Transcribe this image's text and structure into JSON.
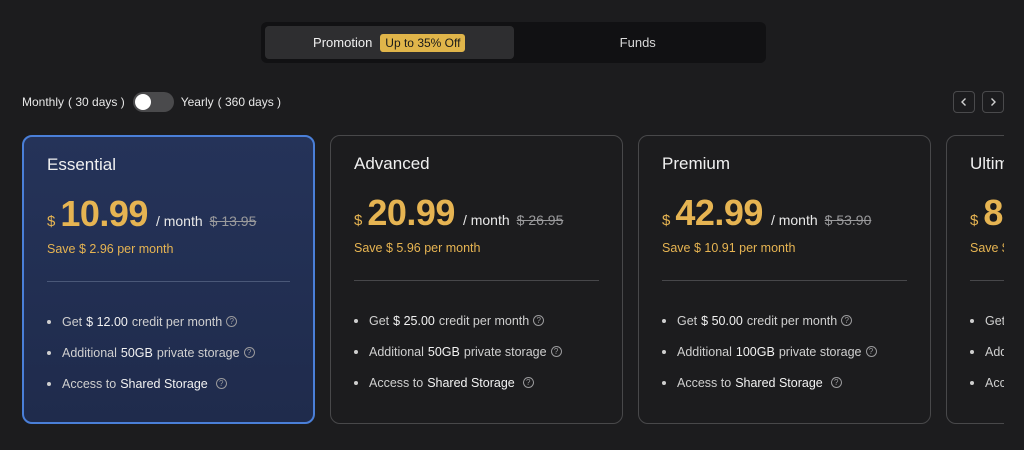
{
  "tabs": {
    "promotion_label": "Promotion",
    "promotion_badge": "Up to 35% Off",
    "funds_label": "Funds"
  },
  "billing": {
    "monthly_label": "Monthly",
    "monthly_days": "( 30 days )",
    "yearly_label": "Yearly",
    "yearly_days": "( 360 days )",
    "toggle_on": false
  },
  "icons": {
    "prev": "chevron-left-icon",
    "next": "chevron-right-icon",
    "help": "question-circle-icon"
  },
  "colors": {
    "accent": "#e6b452",
    "selected_border": "#4a7fd8",
    "selected_bg": "#253359"
  },
  "plans": [
    {
      "name": "Essential",
      "currency": "$",
      "amount": "10.99",
      "per": "/ month",
      "original": "$ 13.95",
      "save": "Save $ 2.96 per month",
      "features": [
        {
          "pre": "Get",
          "strong": "$ 12.00",
          "post": "credit per month"
        },
        {
          "pre": "Additional",
          "strong": "50GB",
          "post": "private storage"
        },
        {
          "pre": "Access to",
          "strong": "Shared Storage",
          "post": ""
        }
      ]
    },
    {
      "name": "Advanced",
      "currency": "$",
      "amount": "20.99",
      "per": "/ month",
      "original": "$ 26.95",
      "save": "Save $ 5.96 per month",
      "features": [
        {
          "pre": "Get",
          "strong": "$ 25.00",
          "post": "credit per month"
        },
        {
          "pre": "Additional",
          "strong": "50GB",
          "post": "private storage"
        },
        {
          "pre": "Access to",
          "strong": "Shared Storage",
          "post": ""
        }
      ]
    },
    {
      "name": "Premium",
      "currency": "$",
      "amount": "42.99",
      "per": "/ month",
      "original": "$ 53.90",
      "save": "Save $ 10.91 per month",
      "features": [
        {
          "pre": "Get",
          "strong": "$ 50.00",
          "post": "credit per month"
        },
        {
          "pre": "Additional",
          "strong": "100GB",
          "post": "private storage"
        },
        {
          "pre": "Access to",
          "strong": "Shared Storage",
          "post": ""
        }
      ]
    },
    {
      "name": "Ultim",
      "currency": "$",
      "amount": "8",
      "per": "",
      "original": "",
      "save": "Save $",
      "features": [
        {
          "pre": "Get",
          "strong": "",
          "post": ""
        },
        {
          "pre": "Add",
          "strong": "",
          "post": ""
        },
        {
          "pre": "Acc",
          "strong": "",
          "post": ""
        }
      ]
    }
  ]
}
